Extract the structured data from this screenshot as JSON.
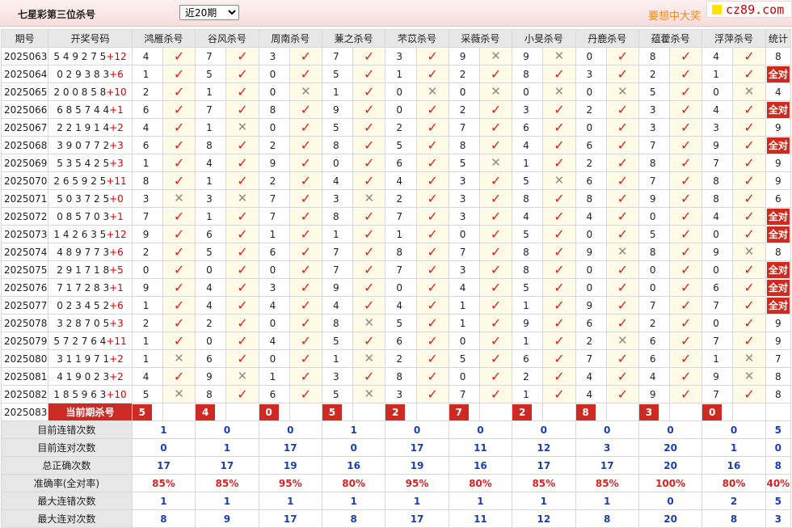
{
  "header": {
    "title": "七星彩第三位杀号",
    "period_select": "近20期",
    "slogan": "要想中大奖",
    "logo": "cz89.com"
  },
  "columns": {
    "period": "期号",
    "numbers": "开奖号码",
    "experts": [
      "鸿雁杀号",
      "谷风杀号",
      "周南杀号",
      "蒹之杀号",
      "芣苡杀号",
      "采薇杀号",
      "小旻杀号",
      "丹鹿杀号",
      "蕴藿杀号",
      "浮萍杀号"
    ],
    "stats": "统计"
  },
  "rows": [
    {
      "period": "2025063",
      "nums": "5 4 9 2 7 5",
      "bonus": "+12",
      "kills": [
        4,
        7,
        3,
        7,
        3,
        9,
        9,
        0,
        8,
        4
      ],
      "ok": [
        1,
        1,
        1,
        1,
        1,
        0,
        0,
        1,
        1,
        1
      ],
      "stat": "8"
    },
    {
      "period": "2025064",
      "nums": "0 2 9 3 8 3",
      "bonus": "+6",
      "kills": [
        1,
        5,
        0,
        5,
        1,
        2,
        8,
        3,
        2,
        1
      ],
      "ok": [
        1,
        1,
        1,
        1,
        1,
        1,
        1,
        1,
        1,
        1
      ],
      "stat": "全对"
    },
    {
      "period": "2025065",
      "nums": "2 0 0 8 5 8",
      "bonus": "+10",
      "kills": [
        2,
        1,
        0,
        1,
        0,
        0,
        0,
        0,
        5,
        0
      ],
      "ok": [
        1,
        1,
        0,
        1,
        0,
        0,
        0,
        0,
        1,
        0
      ],
      "stat": "4"
    },
    {
      "period": "2025066",
      "nums": "6 8 5 7 4 4",
      "bonus": "+1",
      "kills": [
        6,
        7,
        8,
        9,
        0,
        2,
        3,
        2,
        3,
        4
      ],
      "ok": [
        1,
        1,
        1,
        1,
        1,
        1,
        1,
        1,
        1,
        1
      ],
      "stat": "全对"
    },
    {
      "period": "2025067",
      "nums": "2 2 1 9 1 4",
      "bonus": "+2",
      "kills": [
        4,
        1,
        0,
        5,
        2,
        7,
        6,
        0,
        3,
        3
      ],
      "ok": [
        1,
        0,
        1,
        1,
        1,
        1,
        1,
        1,
        1,
        1
      ],
      "stat": "9"
    },
    {
      "period": "2025068",
      "nums": "3 9 0 7 7 2",
      "bonus": "+3",
      "kills": [
        6,
        8,
        2,
        8,
        5,
        8,
        4,
        6,
        7,
        9
      ],
      "ok": [
        1,
        1,
        1,
        1,
        1,
        1,
        1,
        1,
        1,
        1
      ],
      "stat": "全对"
    },
    {
      "period": "2025069",
      "nums": "5 3 5 4 2 5",
      "bonus": "+3",
      "kills": [
        1,
        4,
        9,
        0,
        6,
        5,
        1,
        2,
        8,
        7
      ],
      "ok": [
        1,
        1,
        1,
        1,
        1,
        0,
        1,
        1,
        1,
        1
      ],
      "stat": "9"
    },
    {
      "period": "2025070",
      "nums": "2 6 5 9 2 5",
      "bonus": "+11",
      "kills": [
        8,
        1,
        2,
        4,
        4,
        3,
        5,
        6,
        7,
        8
      ],
      "ok": [
        1,
        1,
        1,
        1,
        1,
        1,
        0,
        1,
        1,
        1
      ],
      "stat": "9"
    },
    {
      "period": "2025071",
      "nums": "5 0 3 7 2 5",
      "bonus": "+0",
      "kills": [
        3,
        3,
        7,
        3,
        2,
        3,
        8,
        8,
        9,
        8
      ],
      "ok": [
        0,
        0,
        1,
        0,
        1,
        1,
        1,
        1,
        1,
        1
      ],
      "stat": "6"
    },
    {
      "period": "2025072",
      "nums": "0 8 5 7 0 3",
      "bonus": "+1",
      "kills": [
        7,
        1,
        7,
        8,
        7,
        3,
        4,
        4,
        0,
        4
      ],
      "ok": [
        1,
        1,
        1,
        1,
        1,
        1,
        1,
        1,
        1,
        1
      ],
      "stat": "全对"
    },
    {
      "period": "2025073",
      "nums": "1 4 2 6 3 5",
      "bonus": "+12",
      "kills": [
        9,
        6,
        1,
        1,
        1,
        0,
        5,
        0,
        5,
        0
      ],
      "ok": [
        1,
        1,
        1,
        1,
        1,
        1,
        1,
        1,
        1,
        1
      ],
      "stat": "全对"
    },
    {
      "period": "2025074",
      "nums": "4 8 9 7 7 3",
      "bonus": "+6",
      "kills": [
        2,
        5,
        6,
        7,
        8,
        7,
        8,
        9,
        8,
        9
      ],
      "ok": [
        1,
        1,
        1,
        1,
        1,
        1,
        1,
        0,
        1,
        0
      ],
      "stat": "8"
    },
    {
      "period": "2025075",
      "nums": "2 9 1 7 1 8",
      "bonus": "+5",
      "kills": [
        0,
        0,
        0,
        7,
        7,
        3,
        8,
        0,
        0,
        0
      ],
      "ok": [
        1,
        1,
        1,
        1,
        1,
        1,
        1,
        1,
        1,
        1
      ],
      "stat": "全对"
    },
    {
      "period": "2025076",
      "nums": "7 1 7 2 8 3",
      "bonus": "+1",
      "kills": [
        9,
        4,
        3,
        9,
        0,
        4,
        5,
        0,
        0,
        6
      ],
      "ok": [
        1,
        1,
        1,
        1,
        1,
        1,
        1,
        1,
        1,
        1
      ],
      "stat": "全对"
    },
    {
      "period": "2025077",
      "nums": "0 2 3 4 5 2",
      "bonus": "+6",
      "kills": [
        1,
        4,
        4,
        4,
        4,
        1,
        1,
        9,
        7,
        7
      ],
      "ok": [
        1,
        1,
        1,
        1,
        1,
        1,
        1,
        1,
        1,
        1
      ],
      "stat": "全对"
    },
    {
      "period": "2025078",
      "nums": "3 2 8 7 0 5",
      "bonus": "+3",
      "kills": [
        2,
        2,
        0,
        8,
        5,
        1,
        9,
        6,
        2,
        0
      ],
      "ok": [
        1,
        1,
        1,
        0,
        1,
        1,
        1,
        1,
        1,
        1
      ],
      "stat": "9"
    },
    {
      "period": "2025079",
      "nums": "5 7 2 7 6 4",
      "bonus": "+11",
      "kills": [
        1,
        0,
        4,
        5,
        6,
        0,
        1,
        2,
        6,
        7
      ],
      "ok": [
        1,
        1,
        1,
        1,
        1,
        1,
        1,
        0,
        1,
        1
      ],
      "stat": "9"
    },
    {
      "period": "2025080",
      "nums": "3 1 1 9 7 1",
      "bonus": "+2",
      "kills": [
        1,
        6,
        0,
        1,
        2,
        5,
        6,
        7,
        6,
        1
      ],
      "ok": [
        0,
        1,
        1,
        0,
        1,
        1,
        1,
        1,
        1,
        0
      ],
      "stat": "7"
    },
    {
      "period": "2025081",
      "nums": "4 1 9 0 2 3",
      "bonus": "+2",
      "kills": [
        4,
        9,
        1,
        3,
        8,
        0,
        2,
        4,
        4,
        9
      ],
      "ok": [
        1,
        0,
        1,
        1,
        1,
        1,
        1,
        1,
        1,
        0
      ],
      "stat": "8"
    },
    {
      "period": "2025082",
      "nums": "1 8 5 9 6 3",
      "bonus": "+10",
      "kills": [
        5,
        8,
        6,
        5,
        3,
        7,
        1,
        4,
        9,
        7
      ],
      "ok": [
        0,
        1,
        1,
        0,
        1,
        1,
        1,
        1,
        1,
        1
      ],
      "stat": "8"
    }
  ],
  "current": {
    "period": "2025083",
    "label": "当前期杀号",
    "kills": [
      "5",
      "4",
      "0",
      "5",
      "2",
      "7",
      "2",
      "8",
      "3",
      "0"
    ]
  },
  "summary": [
    {
      "label": "目前连错次数",
      "values": [
        "1",
        "0",
        "0",
        "1",
        "0",
        "0",
        "0",
        "0",
        "0",
        "0"
      ],
      "stat": "5",
      "color": "blue"
    },
    {
      "label": "目前连对次数",
      "values": [
        "0",
        "1",
        "17",
        "0",
        "17",
        "11",
        "12",
        "3",
        "20",
        "1"
      ],
      "stat": "0",
      "color": "blue"
    },
    {
      "label": "总正确次数",
      "values": [
        "17",
        "17",
        "19",
        "16",
        "19",
        "16",
        "17",
        "17",
        "20",
        "16"
      ],
      "stat": "8",
      "color": "blue"
    },
    {
      "label": "准确率(全对率)",
      "values": [
        "85%",
        "85%",
        "95%",
        "80%",
        "95%",
        "80%",
        "85%",
        "85%",
        "100%",
        "80%"
      ],
      "stat": "40%",
      "color": "red"
    },
    {
      "label": "最大连错次数",
      "values": [
        "1",
        "1",
        "1",
        "1",
        "1",
        "1",
        "1",
        "1",
        "0",
        "2"
      ],
      "stat": "5",
      "color": "blue"
    },
    {
      "label": "最大连对次数",
      "values": [
        "8",
        "9",
        "17",
        "8",
        "17",
        "11",
        "12",
        "8",
        "20",
        "8"
      ],
      "stat": "3",
      "color": "blue"
    }
  ]
}
